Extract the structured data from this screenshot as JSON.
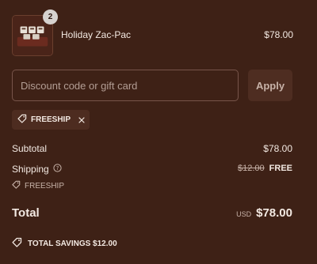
{
  "product": {
    "name": "Holiday Zac-Pac",
    "price": "$78.00",
    "quantity": "2",
    "thumbnail_icon": "product-thumbnail"
  },
  "discount": {
    "placeholder": "Discount code or gift card",
    "value": "",
    "apply_label": "Apply",
    "applied_code": "FREESHIP"
  },
  "summary": {
    "subtotal_label": "Subtotal",
    "subtotal_value": "$78.00",
    "shipping_label": "Shipping",
    "shipping_original": "$12.00",
    "shipping_value": "FREE",
    "shipping_code": "FREESHIP",
    "total_label": "Total",
    "currency": "USD",
    "total_value": "$78.00",
    "savings_text": "TOTAL SAVINGS  $12.00"
  },
  "colors": {
    "background": "#3e2116",
    "text": "#f3e9e2",
    "muted": "#c7b2a8",
    "chip": "#4d2c20"
  }
}
